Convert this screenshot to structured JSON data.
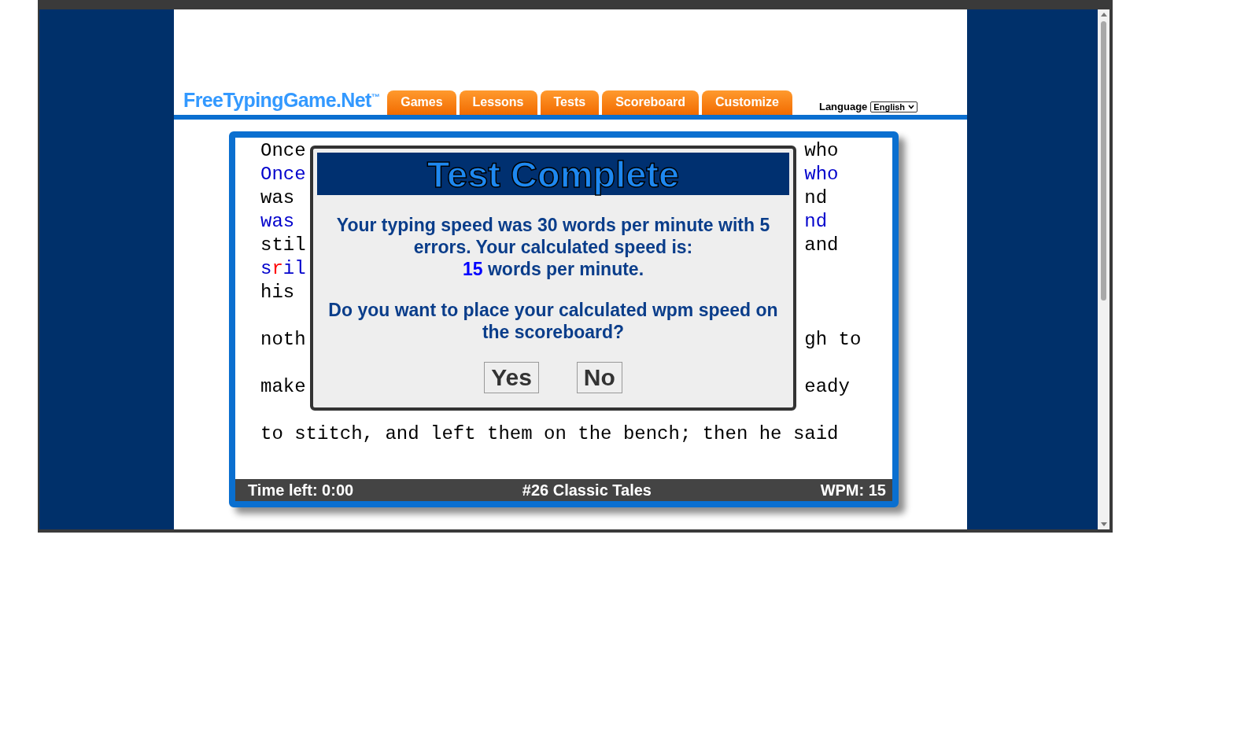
{
  "site": {
    "logo": "FreeTypingGame.Net",
    "trademark": "™"
  },
  "nav_tabs": [
    {
      "label": "Games"
    },
    {
      "label": "Lessons"
    },
    {
      "label": "Tests"
    },
    {
      "label": "Scoreboard"
    },
    {
      "label": "Customize"
    }
  ],
  "language": {
    "label": "Language",
    "value": "English"
  },
  "passage": {
    "lines": [
      {
        "kind": "source",
        "left": [
          {
            "text": "Once",
            "error": false
          }
        ],
        "right": [
          {
            "text": "who",
            "error": false
          }
        ]
      },
      {
        "kind": "typed",
        "left": [
          {
            "text": "Once",
            "error": false
          }
        ],
        "right": [
          {
            "text": "who",
            "error": false
          }
        ]
      },
      {
        "kind": "source",
        "left": [
          {
            "text": "was",
            "error": false
          }
        ],
        "right": [
          {
            "text": "nd",
            "error": false
          }
        ]
      },
      {
        "kind": "typed",
        "left": [
          {
            "text": "was",
            "error": false
          }
        ],
        "right": [
          {
            "text": "nd",
            "error": false
          }
        ]
      },
      {
        "kind": "source",
        "left": [
          {
            "text": "stil",
            "error": false
          }
        ],
        "right": [
          {
            "text": "and",
            "error": false
          }
        ]
      },
      {
        "kind": "typed",
        "left": [
          {
            "text": "s",
            "error": false
          },
          {
            "text": "r",
            "error": true
          },
          {
            "text": "il",
            "error": false
          }
        ]
      },
      {
        "kind": "source",
        "left": [
          {
            "text": "his",
            "error": false
          }
        ]
      },
      {
        "kind": "blank"
      },
      {
        "kind": "source",
        "left": [
          {
            "text": "noth",
            "error": false
          }
        ],
        "right": [
          {
            "text": "gh to",
            "error": false
          }
        ]
      },
      {
        "kind": "blank"
      },
      {
        "kind": "source",
        "left": [
          {
            "text": "make",
            "error": false
          }
        ],
        "right": [
          {
            "text": "eady",
            "error": false
          }
        ]
      },
      {
        "kind": "blank"
      },
      {
        "kind": "source",
        "left": [
          {
            "text": "to stitch, and left them on the bench; then he said",
            "error": false
          }
        ]
      }
    ]
  },
  "dialog": {
    "title": "Test Complete",
    "message": "Your typing speed was 30 words per minute with 5 errors. Your calculated speed is:",
    "speed_value": "15",
    "speed_unit": "words per minute.",
    "question": "Do you want to place your calculated wpm speed on the scoreboard?",
    "buttons": [
      "Yes",
      "No"
    ]
  },
  "status_bar": {
    "time_left": "Time left: 0:00",
    "test_name": "#26 Classic Tales",
    "wpm": "WPM: 15"
  }
}
